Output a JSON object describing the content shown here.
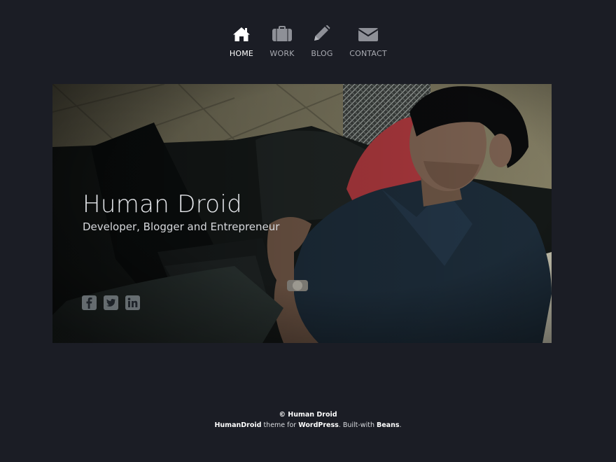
{
  "nav": {
    "items": [
      {
        "label": "HOME",
        "icon": "home-icon",
        "active": true
      },
      {
        "label": "WORK",
        "icon": "briefcase-icon",
        "active": false
      },
      {
        "label": "BLOG",
        "icon": "pencil-icon",
        "active": false
      },
      {
        "label": "CONTACT",
        "icon": "envelope-icon",
        "active": false
      }
    ]
  },
  "hero": {
    "title": "Human Droid",
    "subtitle": "Developer, Blogger and Entrepreneur",
    "social": [
      {
        "icon": "facebook-icon",
        "label": "f"
      },
      {
        "icon": "twitter-icon"
      },
      {
        "icon": "linkedin-icon",
        "label": "in"
      }
    ]
  },
  "footer": {
    "copyright": "© Human Droid",
    "theme_name": "HumanDroid",
    "theme_text": " theme for ",
    "platform": "WordPress",
    "built_text": ". Built-with ",
    "framework": "Beans",
    "end": "."
  },
  "colors": {
    "background": "#1b1d25",
    "nav_active": "#ffffff",
    "nav_inactive": "#a9abb2"
  }
}
